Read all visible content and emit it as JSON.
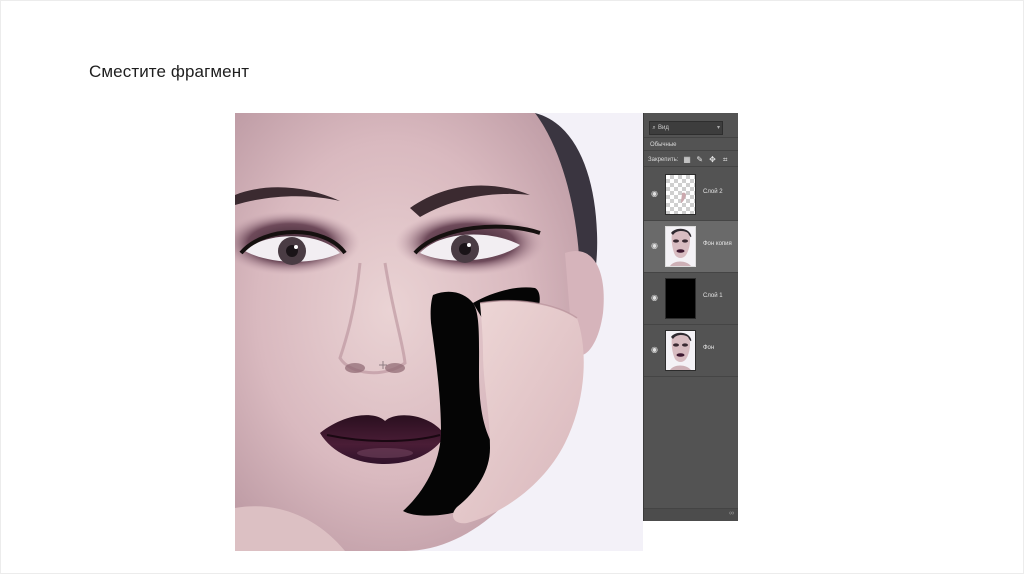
{
  "slide": {
    "title": "Сместите фрагмент"
  },
  "layers_panel": {
    "search_label": "Вид",
    "blend_mode": "Обычные",
    "lock_label": "Закрепить:",
    "lock_icons": [
      "lock-transparent-icon",
      "lock-brush-icon",
      "lock-move-icon",
      "lock-artboard-icon"
    ],
    "layers": [
      {
        "name": "Слой 2",
        "visible": true,
        "active": false,
        "thumb": "transparent"
      },
      {
        "name": "Фон копия",
        "visible": true,
        "active": true,
        "thumb": "portrait"
      },
      {
        "name": "Слой 1",
        "visible": true,
        "active": false,
        "thumb": "black"
      },
      {
        "name": "Фон",
        "visible": true,
        "active": false,
        "thumb": "portrait"
      }
    ],
    "footer_icon": "link-icon"
  },
  "colors": {
    "panel_bg": "#535353",
    "active_layer_bg": "#6a6a6a",
    "lip_color": "#3d1830"
  }
}
